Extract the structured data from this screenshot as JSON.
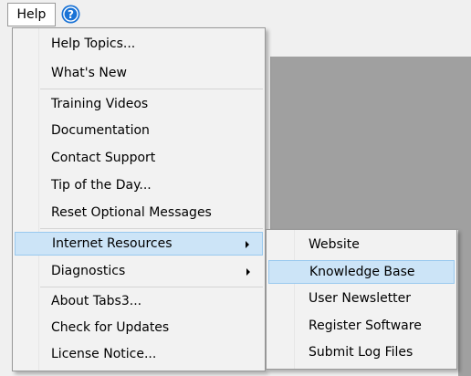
{
  "menubar": {
    "help_label": "Help",
    "help_icon": "question-circle-icon",
    "help_icon_glyph": "?",
    "accent_color": "#1a73d6"
  },
  "help_menu": {
    "items": [
      {
        "label": "Help Topics..."
      },
      {
        "label": "What's New"
      },
      {
        "label": "Training Videos"
      },
      {
        "label": "Documentation"
      },
      {
        "label": "Contact Support"
      },
      {
        "label": "Tip of the Day..."
      },
      {
        "label": "Reset Optional Messages"
      },
      {
        "label": "Internet Resources",
        "has_submenu": true,
        "highlighted": true
      },
      {
        "label": "Diagnostics",
        "has_submenu": true
      },
      {
        "label": "About Tabs3..."
      },
      {
        "label": "Check for Updates"
      },
      {
        "label": "License Notice..."
      }
    ]
  },
  "internet_resources_submenu": {
    "items": [
      {
        "label": "Website"
      },
      {
        "label": "Knowledge Base",
        "highlighted": true
      },
      {
        "label": "User Newsletter"
      },
      {
        "label": "Register Software"
      },
      {
        "label": "Submit Log Files"
      }
    ]
  },
  "colors": {
    "highlight_bg": "#cce4f7",
    "highlight_border": "#99c9ef",
    "workspace_gray": "#a0a0a0"
  }
}
